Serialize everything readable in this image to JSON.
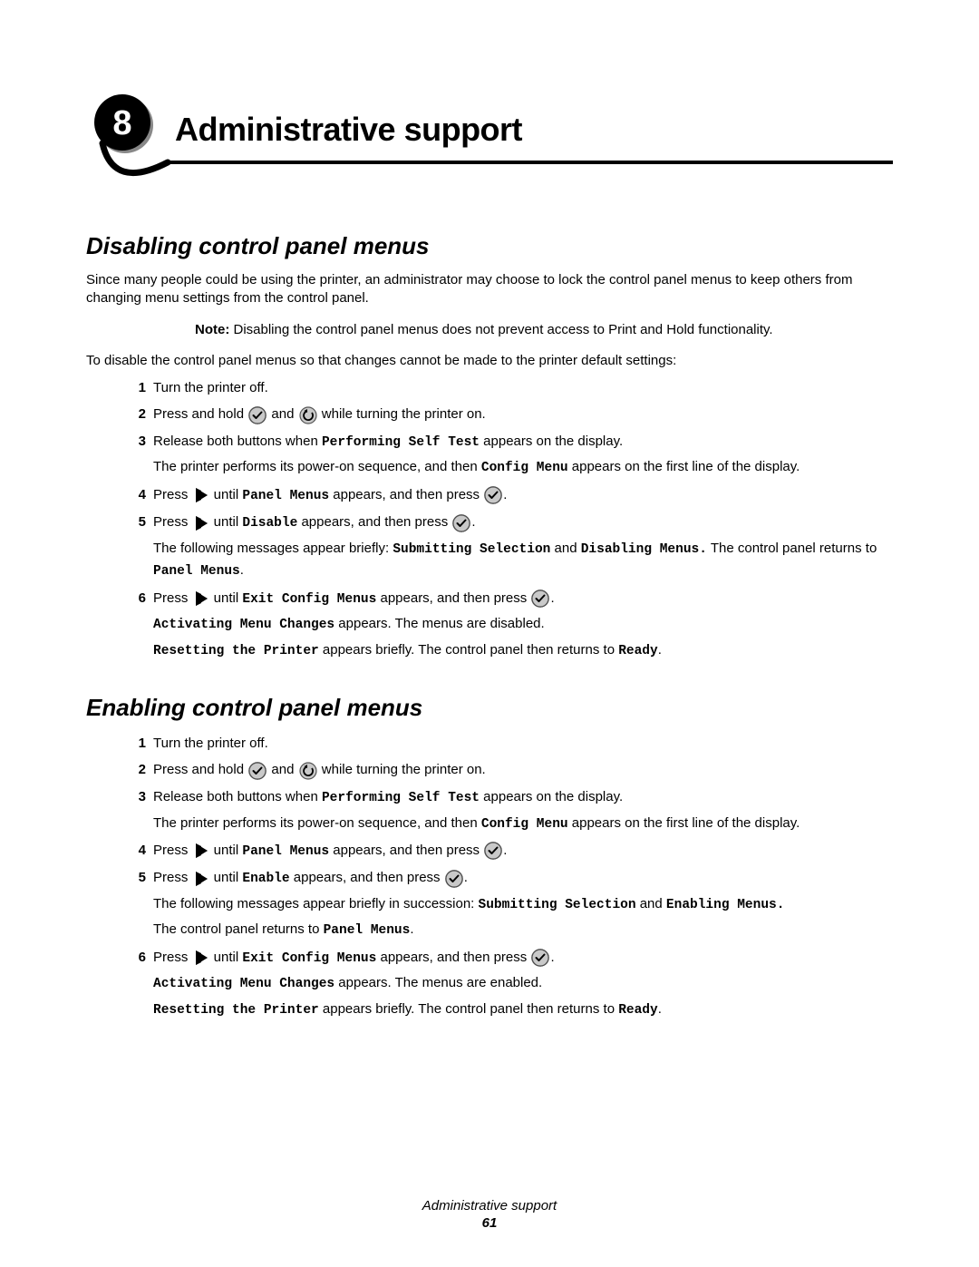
{
  "chapter": {
    "number": "8",
    "title": "Administrative support"
  },
  "section1": {
    "title": "Disabling control panel menus",
    "intro": "Since many people could be using the printer, an administrator may choose to lock the control panel menus to keep others from changing menu settings from the control panel.",
    "note_label": "Note:",
    "note_body": " Disabling the control panel menus does not prevent access to Print and Hold functionality.",
    "lead": "To disable the control panel menus so that changes cannot be made to the printer default settings:",
    "steps": [
      {
        "n": "1",
        "t1": "Turn the printer off."
      },
      {
        "n": "2",
        "t_press": "Press and hold ",
        "t_and": " and ",
        "t_end": " while turning the printer on."
      },
      {
        "n": "3",
        "t1": "Release both buttons when ",
        "m1": "Performing Self Test",
        "t2": " appears on the display.",
        "sub1_a": "The printer performs its power-on sequence, and then ",
        "sub1_m": "Config Menu",
        "sub1_b": " appears on the first line of the display."
      },
      {
        "n": "4",
        "t_press": "Press ",
        "t_until": " until ",
        "m": "Panel Menus",
        "t_app": " appears, and then press ",
        "t_end": "."
      },
      {
        "n": "5",
        "t_press": "Press ",
        "t_until": " until ",
        "m": "Disable",
        "t_app": " appears, and then press ",
        "t_end": ".",
        "sub_a": "The following messages appear briefly: ",
        "sub_m1": "Submitting Selection",
        "sub_and": " and ",
        "sub_m2": "Disabling Menus.",
        "sub_b": " The control panel returns to ",
        "sub_m3": "Panel Menus",
        "sub_c": "."
      },
      {
        "n": "6",
        "t_press": "Press ",
        "t_until": " until ",
        "m": "Exit Config Menus",
        "t_app": " appears, and then press ",
        "t_end": ".",
        "sub1_m": "Activating Menu Changes",
        "sub1_b": " appears. The menus are disabled.",
        "sub2_m": "Resetting the Printer",
        "sub2_b": " appears briefly. The control panel then returns to ",
        "sub2_m2": "Ready",
        "sub2_c": "."
      }
    ]
  },
  "section2": {
    "title": "Enabling control panel menus",
    "steps": [
      {
        "n": "1",
        "t1": "Turn the printer off."
      },
      {
        "n": "2",
        "t_press": "Press and hold ",
        "t_and": " and ",
        "t_end": " while turning the printer on."
      },
      {
        "n": "3",
        "t1": "Release both buttons when ",
        "m1": "Performing Self Test",
        "t2": " appears on the display.",
        "sub1_a": "The printer performs its power-on sequence, and then ",
        "sub1_m": "Config Menu",
        "sub1_b": " appears on the first line of the display."
      },
      {
        "n": "4",
        "t_press": "Press ",
        "t_until": " until ",
        "m": "Panel Menus",
        "t_app": " appears, and then press ",
        "t_end": "."
      },
      {
        "n": "5",
        "t_press": "Press ",
        "t_until": " until ",
        "m": "Enable",
        "t_app": " appears, and then press ",
        "t_end": ".",
        "sub_a": "The following messages appear briefly in succession: ",
        "sub_m1": "Submitting Selection",
        "sub_and": " and ",
        "sub_m2": "Enabling Menus.",
        "sub_b2": "The control panel returns to ",
        "sub_m3": "Panel Menus",
        "sub_c": "."
      },
      {
        "n": "6",
        "t_press": "Press ",
        "t_until": " until ",
        "m": "Exit Config Menus",
        "t_app": " appears, and then press ",
        "t_end": ".",
        "sub1_m": "Activating Menu Changes",
        "sub1_b": " appears. The menus are enabled.",
        "sub2_m": "Resetting the Printer",
        "sub2_b": " appears briefly. The control panel then returns to ",
        "sub2_m2": "Ready",
        "sub2_c": "."
      }
    ]
  },
  "footer": {
    "title": "Administrative support",
    "page": "61"
  }
}
